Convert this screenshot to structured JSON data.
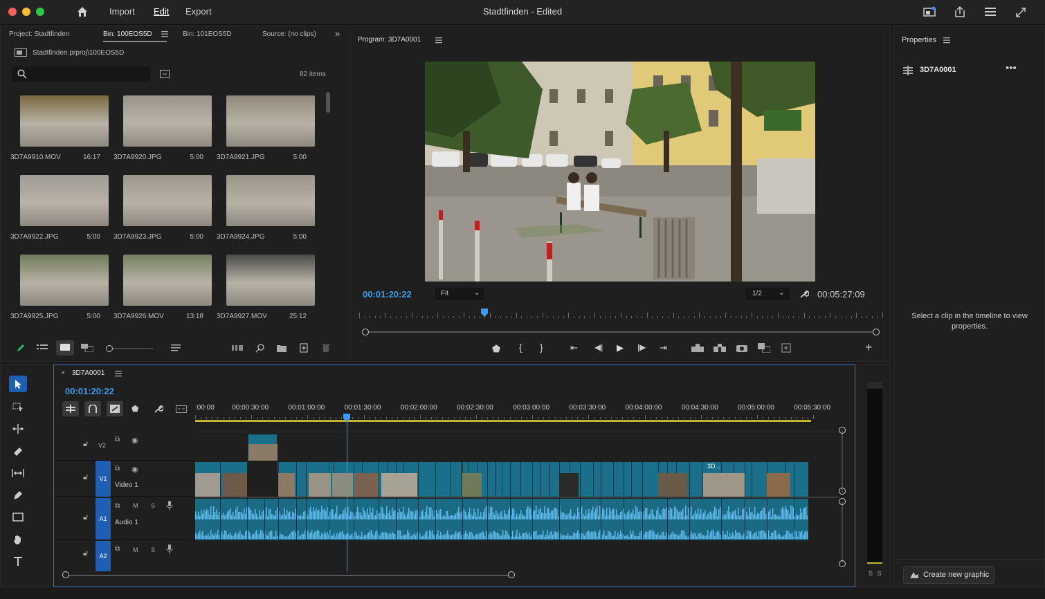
{
  "window": {
    "title": "Stadtfinden - Edited",
    "menu": [
      "Import",
      "Edit",
      "Export"
    ]
  },
  "project": {
    "tabs": [
      "Project: Stadtfinden",
      "Bin: 100EOS5D",
      "Bin: 101EOS5D",
      "Source: (no clips)"
    ],
    "path": "Stadtfinden.prproj\\100EOS5D",
    "search_placeholder": "",
    "item_count": "82 items",
    "clips": [
      {
        "name": "3D7A9910.MOV",
        "dur": "16:17",
        "color": "#7a6a42"
      },
      {
        "name": "3D7A9920.JPG",
        "dur": "5:00",
        "color": "#9a958d"
      },
      {
        "name": "3D7A9921.JPG",
        "dur": "5:00",
        "color": "#8f887a"
      },
      {
        "name": "3D7A9922.JPG",
        "dur": "5:00",
        "color": "#a09c96"
      },
      {
        "name": "3D7A9923.JPG",
        "dur": "5:00",
        "color": "#9c968c"
      },
      {
        "name": "3D7A9924.JPG",
        "dur": "5:00",
        "color": "#9a9388"
      },
      {
        "name": "3D7A9925.JPG",
        "dur": "5:00",
        "color": "#6f7a5a"
      },
      {
        "name": "3D7A9926.MOV",
        "dur": "13:18",
        "color": "#75805f"
      },
      {
        "name": "3D7A9927.MOV",
        "dur": "25:12",
        "color": "#4a4a48"
      }
    ]
  },
  "program": {
    "title": "Program: 3D7A0001",
    "timecode": "00:01:20:22",
    "fit": "Fit",
    "quality": "1/2",
    "duration": "00:05:27:09",
    "playhead_fraction": 0.24
  },
  "properties": {
    "title": "Properties",
    "clip": "3D7A0001",
    "hint": "Select a clip in the timeline to view properties.",
    "create_graphic": "Create new graphic"
  },
  "timeline": {
    "tab": "3D7A0001",
    "timecode": "00:01:20:22",
    "ruler": [
      ":00:00",
      "00:00:30:00",
      "00:01:00:00",
      "00:01:30:00",
      "00:02:00:00",
      "00:02:30:00",
      "00:03:00:00",
      "00:03:30:00",
      "00:04:00:00",
      "00:04:30:00",
      "00:05:00:00",
      "00:05:30:00"
    ],
    "tracks": {
      "v2": "V2",
      "v1": "V1",
      "video1": "Video 1",
      "a1": "A1",
      "audio1": "Audio 1",
      "a2": "A2",
      "m": "M",
      "s": "S"
    },
    "clip_label": "3D...",
    "playhead_fraction": 0.236
  },
  "meter": {
    "labels": "S S"
  }
}
